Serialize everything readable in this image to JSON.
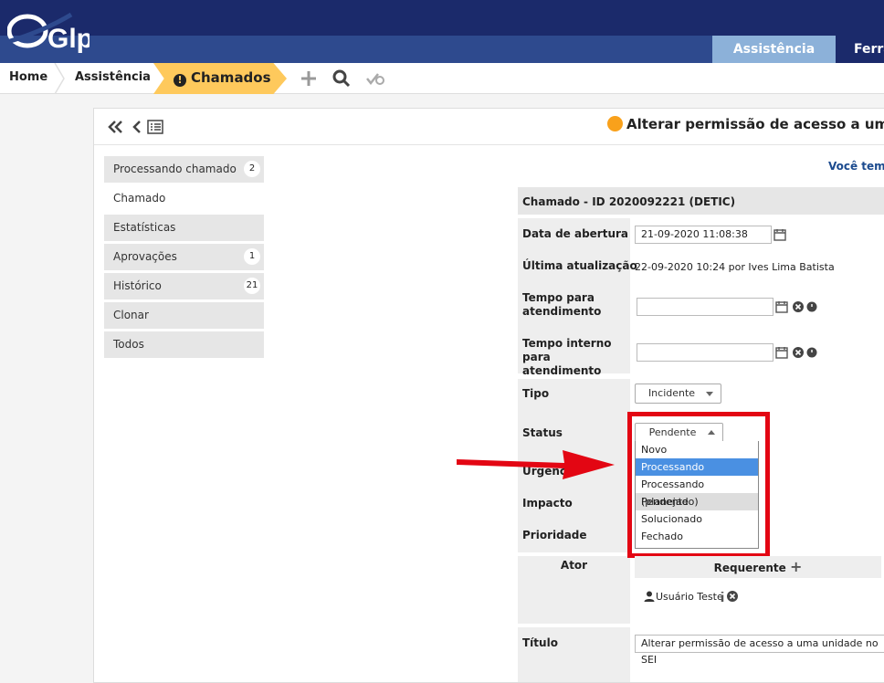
{
  "app": {
    "logo_text": "Glpi"
  },
  "top_menu": {
    "items": [
      {
        "label": "Assistência"
      },
      {
        "label": "Ferra"
      }
    ]
  },
  "breadcrumb": {
    "home": "Home",
    "assist": "Assistência",
    "current": "Chamados"
  },
  "ticket": {
    "title": "Alterar permissão de acesso a uma uni",
    "notice": "Você tem a",
    "section_title": "Chamado - ID 2020092221 (DETIC)"
  },
  "tabs": [
    {
      "label": "Processando chamado",
      "count": "2"
    },
    {
      "label": "Chamado",
      "count": ""
    },
    {
      "label": "Estatísticas",
      "count": ""
    },
    {
      "label": "Aprovações",
      "count": "1"
    },
    {
      "label": "Histórico",
      "count": "21"
    },
    {
      "label": "Clonar",
      "count": ""
    },
    {
      "label": "Todos",
      "count": ""
    }
  ],
  "fields": {
    "opening_date_label": "Data de abertura",
    "opening_date_value": "21-09-2020 11:08:38",
    "last_update_label": "Última atualização",
    "last_update_value": "22-09-2020 10:24 por Ives Lima Batista",
    "time_to_resolve_label": "Tempo para atendimento",
    "internal_time_label": "Tempo interno para atendimento",
    "type_label": "Tipo",
    "type_value": "Incidente",
    "status_label": "Status",
    "status_value": "Pendente",
    "urgency_label": "Urgênci",
    "impact_label": "Impacto",
    "priority_label": "Prioridade",
    "actor_label": "Ator",
    "requester_label": "Requerente",
    "requester_user": "Usuário Teste",
    "title_label": "Título",
    "title_value": "Alterar permissão de acesso a uma unidade no SEI"
  },
  "status_options": [
    "Novo",
    "Processando (atribuído)",
    "Processando (planejado)",
    "Pendente",
    "Solucionado",
    "Fechado"
  ],
  "colors": {
    "topbar": "#1b2a6b",
    "active_crumb": "#fec95c",
    "highlight": "#e30613",
    "selected_option": "#4a90e2"
  }
}
